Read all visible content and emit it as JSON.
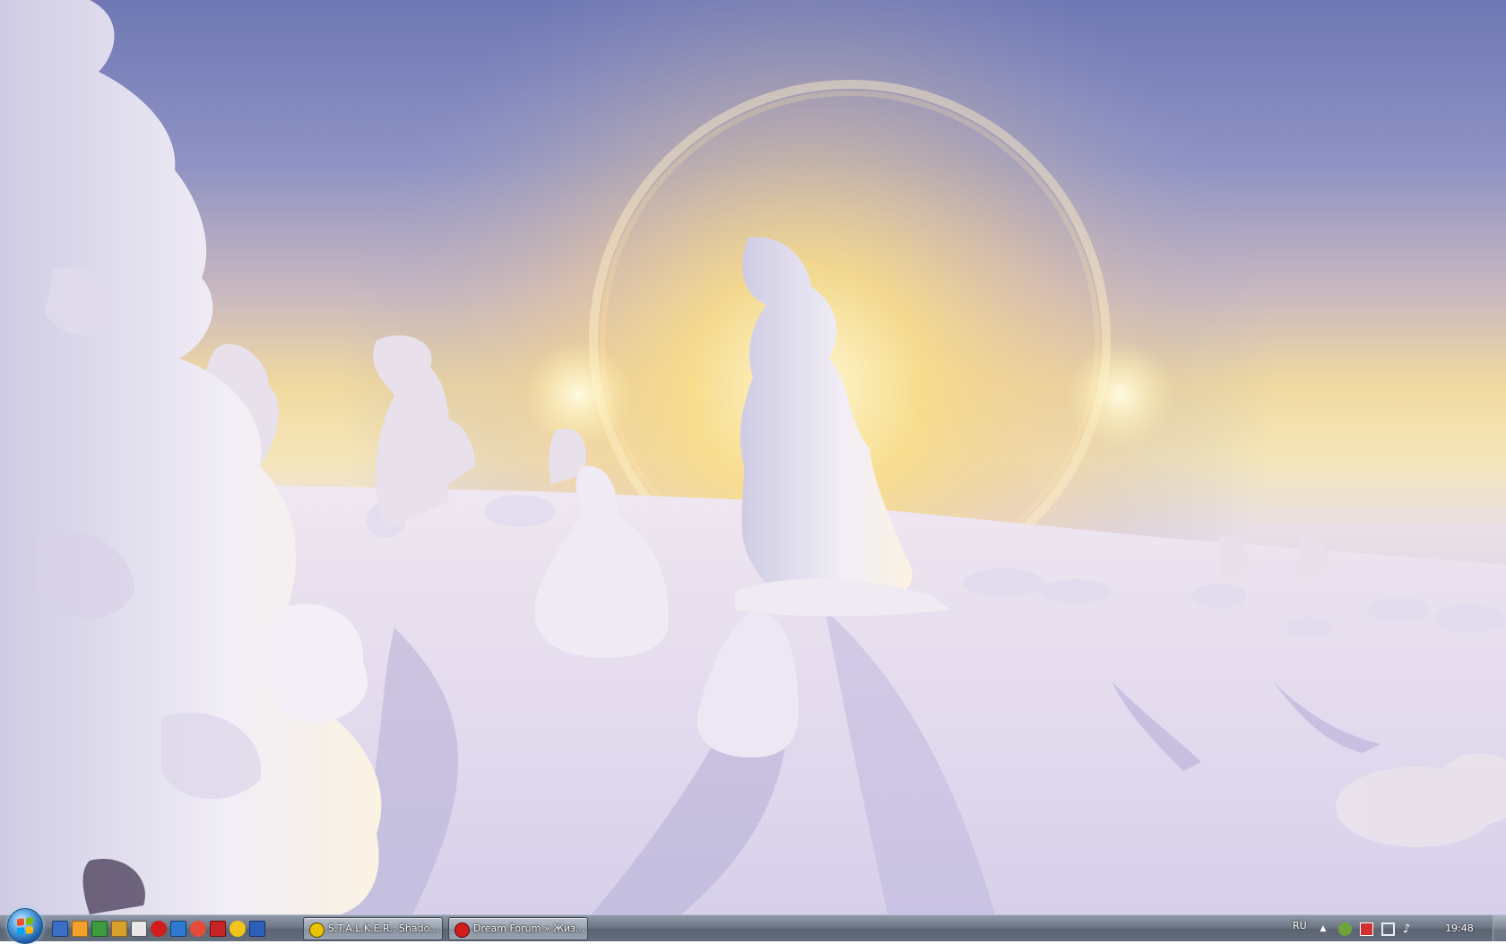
{
  "taskbar": {
    "quick_launch": [
      {
        "name": "floppy-save-icon",
        "color": "#3a6fc4"
      },
      {
        "name": "media-player-icon",
        "color": "#f2a22a"
      },
      {
        "name": "download-arrow-icon",
        "color": "#3d9a3d"
      },
      {
        "name": "tools-icon",
        "color": "#d8a12c"
      },
      {
        "name": "settings-gear-icon",
        "color": "#e8e8e8"
      },
      {
        "name": "opera-icon",
        "color": "#d11d1d"
      },
      {
        "name": "picture-viewer-icon",
        "color": "#2f7ad1"
      },
      {
        "name": "chrome-icon",
        "color": "#e44b3a"
      },
      {
        "name": "antivirus-icon",
        "color": "#c72525"
      },
      {
        "name": "aim-icon",
        "color": "#f0c419"
      },
      {
        "name": "word-icon",
        "color": "#2b5fb8"
      }
    ],
    "tasks": [
      {
        "label": "S.T.A.L.K.E.R.: Shado...",
        "icon": "radiation-icon",
        "icon_color": "#e6c400"
      },
      {
        "label": "Dream Forum » Жиз...",
        "icon": "opera-icon",
        "icon_color": "#d11d1d"
      }
    ],
    "tray": {
      "language": "RU",
      "clock": "19:48",
      "icons": [
        "show-hidden-arrow-icon",
        "tray-app-icon",
        "tray-flag-icon",
        "network-icon",
        "volume-icon"
      ]
    }
  }
}
